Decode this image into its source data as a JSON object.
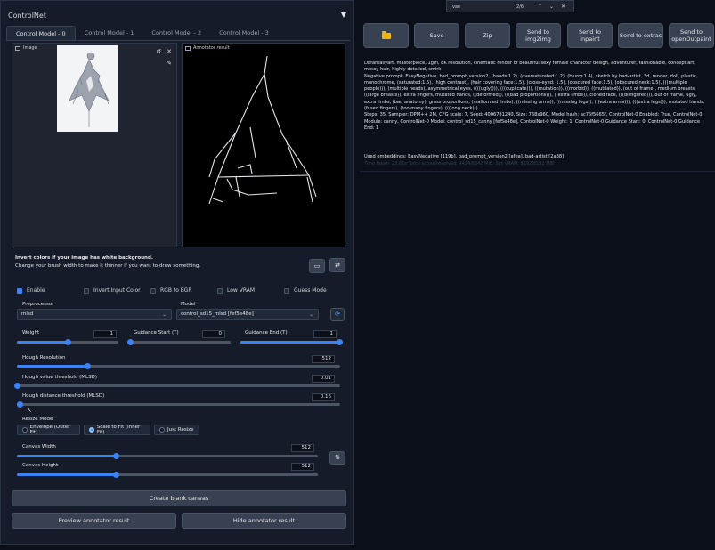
{
  "controlnet": {
    "header": "ControlNet",
    "tabs": [
      {
        "label": "Control Model - 0",
        "active": true
      },
      {
        "label": "Control Model - 1",
        "active": false
      },
      {
        "label": "Control Model - 2",
        "active": false
      },
      {
        "label": "Control Model - 3",
        "active": false
      }
    ],
    "image_label": "Image",
    "annotator_label": "Annotator result",
    "hint_line1": "Invert colors if your image has white background.",
    "hint_line2": "Change your brush width to make it thinner if you want to draw something.",
    "checkboxes": {
      "enable": {
        "label": "Enable",
        "checked": true
      },
      "invert": {
        "label": "Invert Input Color",
        "checked": false
      },
      "rgb2bgr": {
        "label": "RGB to BGR",
        "checked": false
      },
      "lowvram": {
        "label": "Low VRAM",
        "checked": false
      },
      "guess": {
        "label": "Guess Mode",
        "checked": false
      }
    },
    "preprocessor": {
      "label": "Preprocessor",
      "value": "mlsd"
    },
    "model": {
      "label": "Model",
      "value": "control_sd15_mlsd [fef5e48e]"
    },
    "weight": {
      "label": "Weight",
      "value": "1",
      "fraction": 0.5
    },
    "guidance_start": {
      "label": "Guidance Start (T)",
      "value": "0",
      "fraction": 0.0
    },
    "guidance_end": {
      "label": "Guidance End (T)",
      "value": "1",
      "fraction": 1.0
    },
    "hough_resolution": {
      "label": "Hough Resolution",
      "value": "512",
      "fraction": 0.22
    },
    "hough_value": {
      "label": "Hough value threshold (MLSD)",
      "value": "0.01",
      "fraction": 0.0
    },
    "hough_distance": {
      "label": "Hough distance threshold (MLSD)",
      "value": "0.16",
      "fraction": 0.01
    },
    "resize_mode": {
      "label": "Resize Mode",
      "options": [
        {
          "label": "Envelope (Outer Fit)",
          "selected": false
        },
        {
          "label": "Scale to Fit (Inner Fit)",
          "selected": true
        },
        {
          "label": "Just Resize",
          "selected": false
        }
      ]
    },
    "canvas_width": {
      "label": "Canvas Width",
      "value": "512",
      "fraction": 0.33
    },
    "canvas_height": {
      "label": "Canvas Height",
      "value": "512",
      "fraction": 0.33
    },
    "create_canvas": "Create blank canvas",
    "preview": "Preview annotator result",
    "hide": "Hide annotator result"
  },
  "find": {
    "query": "vae",
    "count": "2/6"
  },
  "actions": {
    "save": "Save",
    "zip": "Zip",
    "img2img": "Send to\nimg2img",
    "inpaint": "Send to\ninpaint",
    "extras": "Send to extras",
    "openoutpaint": "Send to\nopenOutpaint"
  },
  "generation_info": {
    "prompt": "D8fantasyart, masterpiece, 1girl, 8K resolution, cinematic render of beautiful sexy female character design, adventurer, fashionable, concept art, messy hair, highly detailed, smirk",
    "negative": "Negative prompt: EasyNegative, bad_prompt_version2, (hands:1.2), (oversaturated:1.2), (blurry:1.4), sketch by bad-artist, 3d, render, doll, plastic, monochrome, (saturated:1.5), (high contrast), (hair covering face:1.5), (cross-eyed: 1.5), (obscured face:1.5), (obscured neck:1.5), (((multiple people))), (multiple heads), asymmetrical eyes, ((((ugly)))), (((duplicate))), ((mutation)), ((morbid)), ((mutilated)), (out of frame), medium breasts, ((large breasts)), extra fingers, mutated hands, ((deformed)), (((bad proportions))), ((extra limbs)), cloned face, (((disfigured))), out of frame, ugly, extra limbs, (bad anatomy), gross proportions, (malformed limbs), ((missing arms)), ((missing legs)), (((extra arms))), (((extra legs))), mutated hands, (fused fingers), (too many fingers), (((long neck)))",
    "params": "Steps: 35, Sampler: DPM++ 2M, CFG scale: 7, Seed: 4006781240, Size: 768x960, Model hash: ac75f5665f, ControlNet-0 Enabled: True, ControlNet-0 Module: canny, ControlNet-0 Model: control_sd15_canny [fef5e48e], ControlNet-0 Weight: 1, ControlNet-0 Guidance Start: 0, ControlNet-0 Guidance End: 1",
    "embeddings": "Used embeddings: EasyNegative [119b], bad_prompt_version2 [afea], bad-artist [2a38]",
    "embeddings_faded": "Time taken: 23.61s  Torch active/reserved: 4424/6342 MiB, Sys VRAM: 8192/8192 MiB"
  },
  "colors": {
    "accent": "#3b82f6",
    "background": "#0b0f19",
    "panel": "#151b28",
    "button": "#374151",
    "folder": "#f5b400"
  }
}
